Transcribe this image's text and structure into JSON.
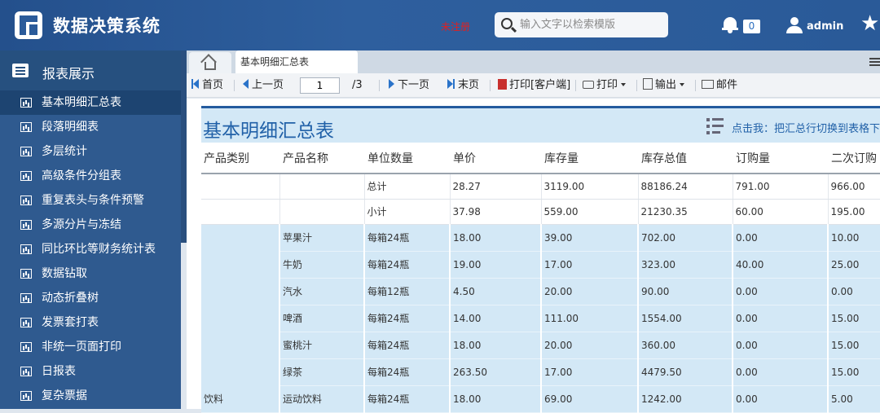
{
  "app": {
    "title": "数据决策系统",
    "unregistered": "未注册",
    "notification_count": "0",
    "username": "admin"
  },
  "search": {
    "placeholder": "输入文字以检索模版"
  },
  "sidebar": {
    "header": "报表展示",
    "items": [
      {
        "label": "基本明细汇总表",
        "active": true
      },
      {
        "label": "段落明细表"
      },
      {
        "label": "多层统计"
      },
      {
        "label": "高级条件分组表"
      },
      {
        "label": "重复表头与条件预警"
      },
      {
        "label": "多源分片与冻结"
      },
      {
        "label": "同比环比等财务统计表"
      },
      {
        "label": "数据钻取"
      },
      {
        "label": "动态折叠树"
      },
      {
        "label": "发票套打表"
      },
      {
        "label": "非统一页面打印"
      },
      {
        "label": "日报表"
      },
      {
        "label": "复杂票据"
      }
    ]
  },
  "tabs": {
    "active_tab": "基本明细汇总表"
  },
  "toolbar": {
    "first": "首页",
    "prev": "上一页",
    "page": "1",
    "total": "/3",
    "next": "下一页",
    "last": "末页",
    "print_client": "打印[客户端]",
    "print": "打印",
    "export": "输出",
    "mail": "邮件"
  },
  "report": {
    "title": "基本明细汇总表",
    "switch_hint": "点击我：把汇总行切换到表格下",
    "headers": [
      "产品类别",
      "产品名称",
      "单位数量",
      "单价",
      "库存量",
      "库存总值",
      "订购量",
      "二次订购"
    ],
    "summary_rows": [
      {
        "label": "总计",
        "price": "28.27",
        "stock": "3119.00",
        "value": "88186.24",
        "order": "791.00",
        "reorder": "966.00"
      },
      {
        "label": "小计",
        "price": "37.98",
        "stock": "559.00",
        "value": "21230.35",
        "order": "60.00",
        "reorder": "195.00"
      }
    ],
    "category": "饮料",
    "rows": [
      {
        "name": "苹果汁",
        "unit": "每箱24瓶",
        "price": "18.00",
        "stock": "39.00",
        "value": "702.00",
        "order": "0.00",
        "reorder": "10.00"
      },
      {
        "name": "牛奶",
        "unit": "每箱24瓶",
        "price": "19.00",
        "stock": "17.00",
        "value": "323.00",
        "order": "40.00",
        "reorder": "25.00"
      },
      {
        "name": "汽水",
        "unit": "每箱12瓶",
        "price": "4.50",
        "stock": "20.00",
        "value": "90.00",
        "order": "0.00",
        "reorder": "0.00"
      },
      {
        "name": "啤酒",
        "unit": "每箱24瓶",
        "price": "14.00",
        "stock": "111.00",
        "value": "1554.00",
        "order": "0.00",
        "reorder": "15.00"
      },
      {
        "name": "蜜桃汁",
        "unit": "每箱24瓶",
        "price": "18.00",
        "stock": "20.00",
        "value": "360.00",
        "order": "0.00",
        "reorder": "15.00"
      },
      {
        "name": "绿茶",
        "unit": "每箱24瓶",
        "price": "263.50",
        "stock": "17.00",
        "value": "4479.50",
        "order": "0.00",
        "reorder": "15.00"
      },
      {
        "name": "运动饮料",
        "unit": "每箱24瓶",
        "price": "18.00",
        "stock": "69.00",
        "value": "1242.00",
        "order": "0.00",
        "reorder": "5.00"
      }
    ]
  }
}
